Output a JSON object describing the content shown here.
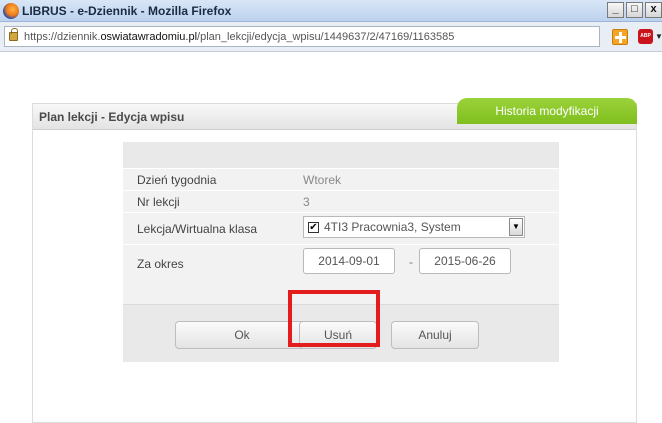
{
  "window": {
    "title": "LIBRUS - e-Dziennik - Mozilla Firefox",
    "controls": [
      "_",
      "□",
      "x"
    ]
  },
  "address": {
    "url_prefix": "https://dziennik.",
    "url_domain": "oswiatawradomiu.pl",
    "url_path": "/plan_lekcji/edycja_wpisu/1449637/2/47169/1163585"
  },
  "toolbar": {
    "abp_label": "ABP",
    "dropdown": "▼"
  },
  "panel": {
    "title": "Plan lekcji - Edycja wpisu",
    "history_tab": "Historia modyfikacji"
  },
  "form": {
    "day_label": "Dzień tygodnia",
    "day_value": "Wtorek",
    "lesson_label": "Nr lekcji",
    "lesson_value": "3",
    "class_label": "Lekcja/Wirtualna klasa",
    "class_checked": "✔",
    "class_value": "4TI3 Pracownia3, System",
    "period_label": "Za okres",
    "date_from": "2014-09-01",
    "date_sep": "-",
    "date_to": "2015-06-26"
  },
  "buttons": {
    "ok": "Ok",
    "delete": "Usuń",
    "cancel": "Anuluj"
  },
  "colors": {
    "accent_green": "#8cc82a",
    "highlight_red": "#e31d1d"
  }
}
